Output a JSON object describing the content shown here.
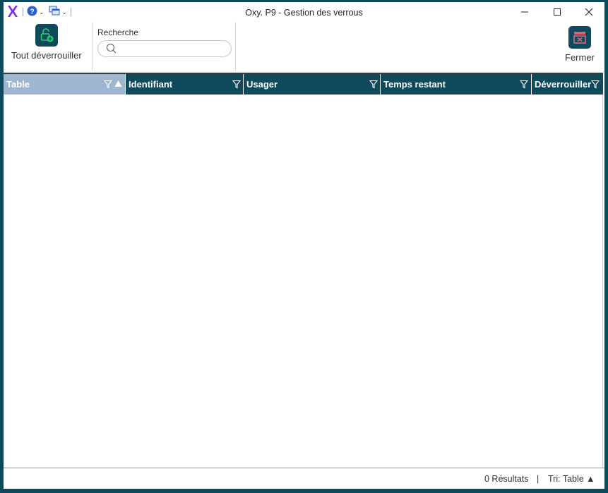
{
  "window": {
    "title": "Oxy. P9 - Gestion des verrous"
  },
  "ribbon": {
    "unlock_all_label": "Tout déverrouiller",
    "search_label": "Recherche",
    "search_value": "",
    "close_label": "Fermer"
  },
  "grid": {
    "columns": [
      {
        "label": "Table",
        "sorted": "ascending"
      },
      {
        "label": "Identifiant"
      },
      {
        "label": "Usager"
      },
      {
        "label": "Temps restant"
      },
      {
        "label": "Déverrouiller"
      }
    ],
    "rows": []
  },
  "status": {
    "results_text": "0 Résultats",
    "separator": "|",
    "sort_text": "Tri: Table ▲"
  },
  "colors": {
    "accent": "#0f4a5c",
    "header_active": "#9fb6cf",
    "logo": "#7b2ff2",
    "help": "#2f5fd0",
    "lock_green": "#2ecc71",
    "close_icon": "#e0617a"
  }
}
